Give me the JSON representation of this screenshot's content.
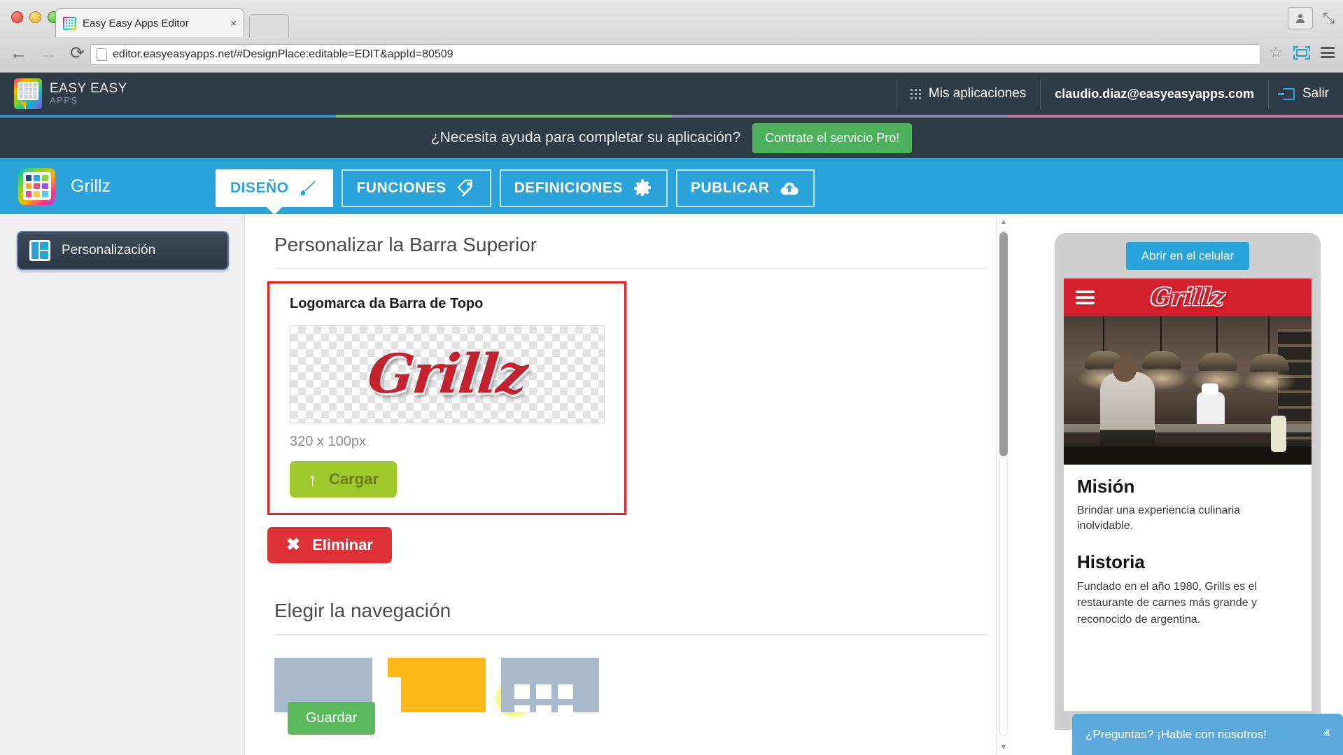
{
  "browser": {
    "tab_title": "Easy Easy Apps Editor",
    "tab_close": "×",
    "url": "editor.easyeasyapps.net/#DesignPlace:editable=EDIT&appId=80509",
    "back_icon": "←",
    "forward_icon": "→",
    "reload_icon": "⟳",
    "star_icon": "☆",
    "expand_icon": "⤡"
  },
  "header": {
    "brand_line1": "EASY EASY",
    "brand_line2": "APPS",
    "my_apps": "Mis aplicaciones",
    "account_email": "claudio.diaz@easyeasyapps.com",
    "logout": "Salir",
    "stripe_colors": [
      "#3a8fc4",
      "#76c06f",
      "#8a8aa8",
      "#c474a8"
    ]
  },
  "pro_banner": {
    "message": "¿Necesita ayuda para completar su aplicación?",
    "button": "Contrate el servicio Pro!",
    "button_color": "#4cb05c"
  },
  "app_bar": {
    "app_name": "Grillz",
    "accent_color": "#2aa3da",
    "tabs": [
      {
        "label": "DISEÑO",
        "icon": "brush-icon",
        "active": true
      },
      {
        "label": "FUNCIONES",
        "icon": "tags-icon",
        "active": false
      },
      {
        "label": "DEFINICIONES",
        "icon": "gear-icon",
        "active": false
      },
      {
        "label": "PUBLICAR",
        "icon": "upload-cloud-icon",
        "active": false
      }
    ]
  },
  "sidebar": {
    "items": [
      {
        "label": "Personalización",
        "icon": "layout-icon",
        "active": true
      }
    ]
  },
  "main": {
    "section_title": "Personalizar la Barra Superior",
    "logo_card": {
      "label": "Logomarca da Barra de Topo",
      "logo_text": "Grillz",
      "dimensions": "320 x 100px",
      "upload_button": "Cargar",
      "upload_icon": "↑",
      "highlight_color": "#f01f1f"
    },
    "delete_button": "Eliminar",
    "delete_icon": "✖",
    "nav_section_title": "Elegir la navegación",
    "nav_options": [
      {
        "name": "plain",
        "selected": false,
        "color": "#a9b9cc"
      },
      {
        "name": "side-drawer",
        "selected": true,
        "color": "#ffb819"
      },
      {
        "name": "grid",
        "selected": false,
        "color": "#a9b9cc"
      }
    ],
    "save_button": "Guardar"
  },
  "preview": {
    "open_mobile_button": "Abrir en el celular",
    "app_logo_text": "Grillz",
    "topbar_color": "#d41f2c",
    "sections": [
      {
        "heading": "Misión",
        "text": "Brindar una experiencia culinaria inolvidable."
      },
      {
        "heading": "Historia",
        "text": "Fundado en el año 1980, Grills es el restaurante de carnes más grande y reconocido de argentina."
      }
    ]
  },
  "chat_widget": {
    "text": "¿Preguntas? ¡Hable con nosotros!",
    "chevron": "ⱏ"
  }
}
